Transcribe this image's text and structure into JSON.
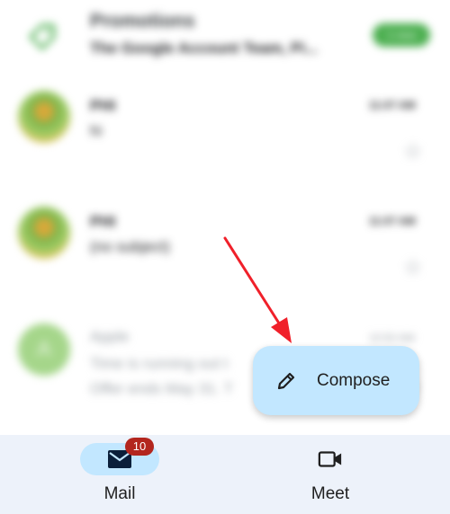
{
  "inbox": {
    "promotions": {
      "title": "Promotions",
      "subtitle": "The Google Account Team, Pi...",
      "badge": "1 new"
    },
    "emails": [
      {
        "sender": "PHI",
        "subject": "hi",
        "time": "11:07 AM"
      },
      {
        "sender": "PHI",
        "subject": "(no subject)",
        "time": "11:07 AM"
      },
      {
        "sender": "Apple",
        "avatar_letter": "A",
        "subject": "Time is running out t",
        "snippet": "Offer ends May 31. T",
        "time": "10:50 AM"
      }
    ]
  },
  "fab": {
    "label": "Compose",
    "icon": "pencil-icon"
  },
  "bottom_nav": {
    "mail": {
      "label": "Mail",
      "badge": "10",
      "icon": "mail-icon"
    },
    "meet": {
      "label": "Meet",
      "icon": "video-camera-icon"
    }
  },
  "colors": {
    "accent": "#c2e7ff",
    "nav_background": "#edf2fa",
    "badge": "#b3261e",
    "arrow": "#f0202a"
  }
}
